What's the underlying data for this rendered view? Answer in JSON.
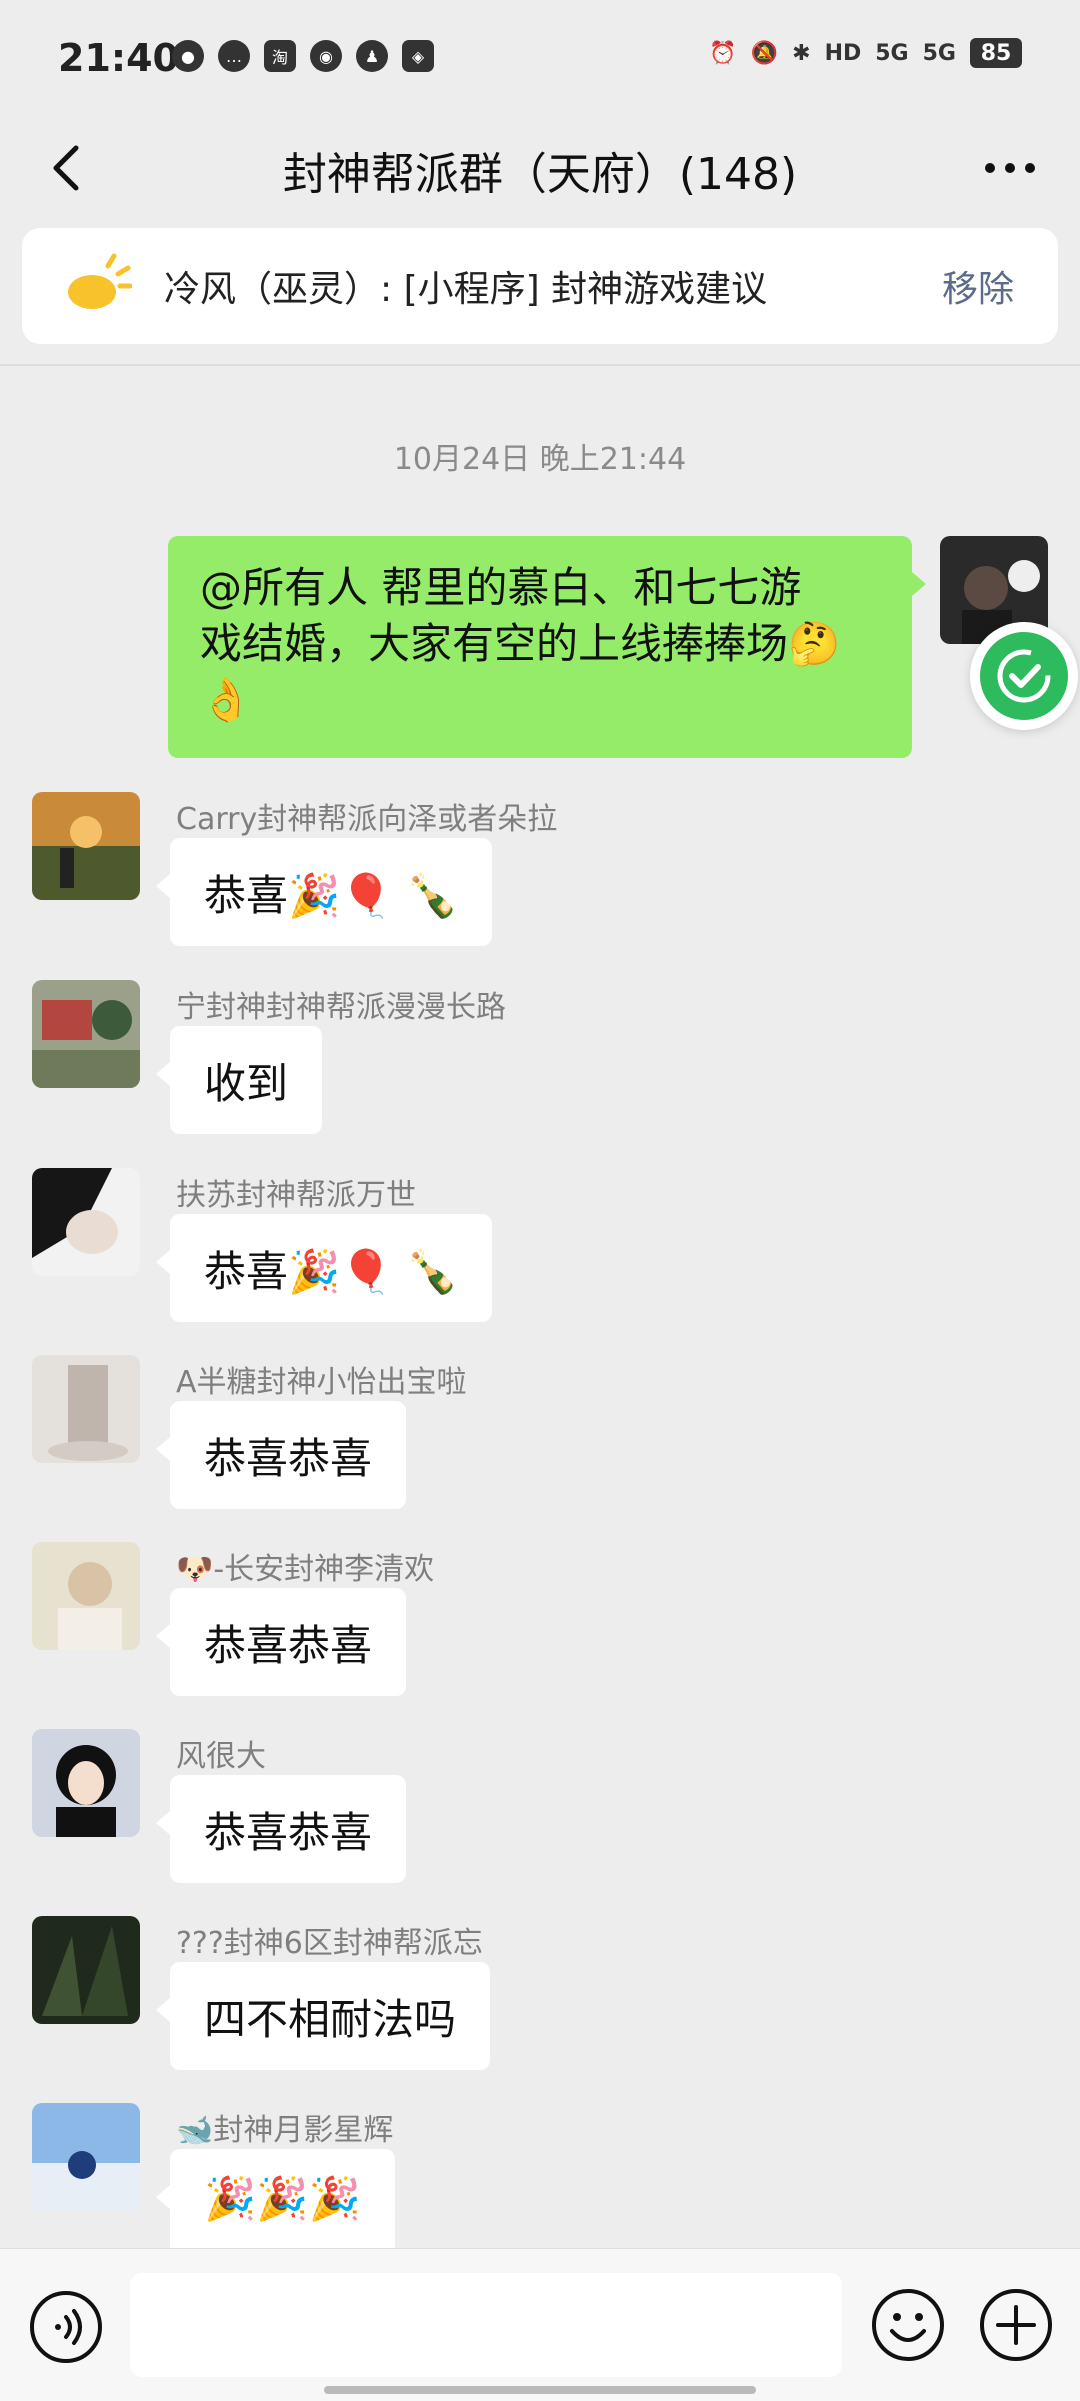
{
  "status_bar": {
    "time": "21:40",
    "network": "5G",
    "battery": "85"
  },
  "header": {
    "title": "封神帮派群（天府）(148)"
  },
  "notice": {
    "text": "冷风（巫灵）: [小程序] 封神游戏建议",
    "remove_label": "移除"
  },
  "timestamp": "10月24日 晚上21:44",
  "sent_message": {
    "line1": "@所有人  帮里的慕白、和七七游",
    "line2": "戏结婚，大家有空的上线捧捧场🤔",
    "line3": "👌"
  },
  "messages": [
    {
      "name": "Carry封神帮派向泽或者朵拉",
      "text": "恭喜🎉🎈 🍾"
    },
    {
      "name": "宁封神封神帮派漫漫长路",
      "text": "收到"
    },
    {
      "name": "扶苏封神帮派万世",
      "text": "恭喜🎉🎈 🍾"
    },
    {
      "name": "A半糖封神小怡出宝啦",
      "text": "恭喜恭喜"
    },
    {
      "name": "🐶-长安封神李清欢",
      "text": "恭喜恭喜"
    },
    {
      "name": "风很大",
      "text": "恭喜恭喜"
    },
    {
      "name": "???封神6区封神帮派忘",
      "text": "四不相耐法吗"
    },
    {
      "name": "🐋封神月影星辉",
      "text": "🎉🎉🎉"
    }
  ]
}
